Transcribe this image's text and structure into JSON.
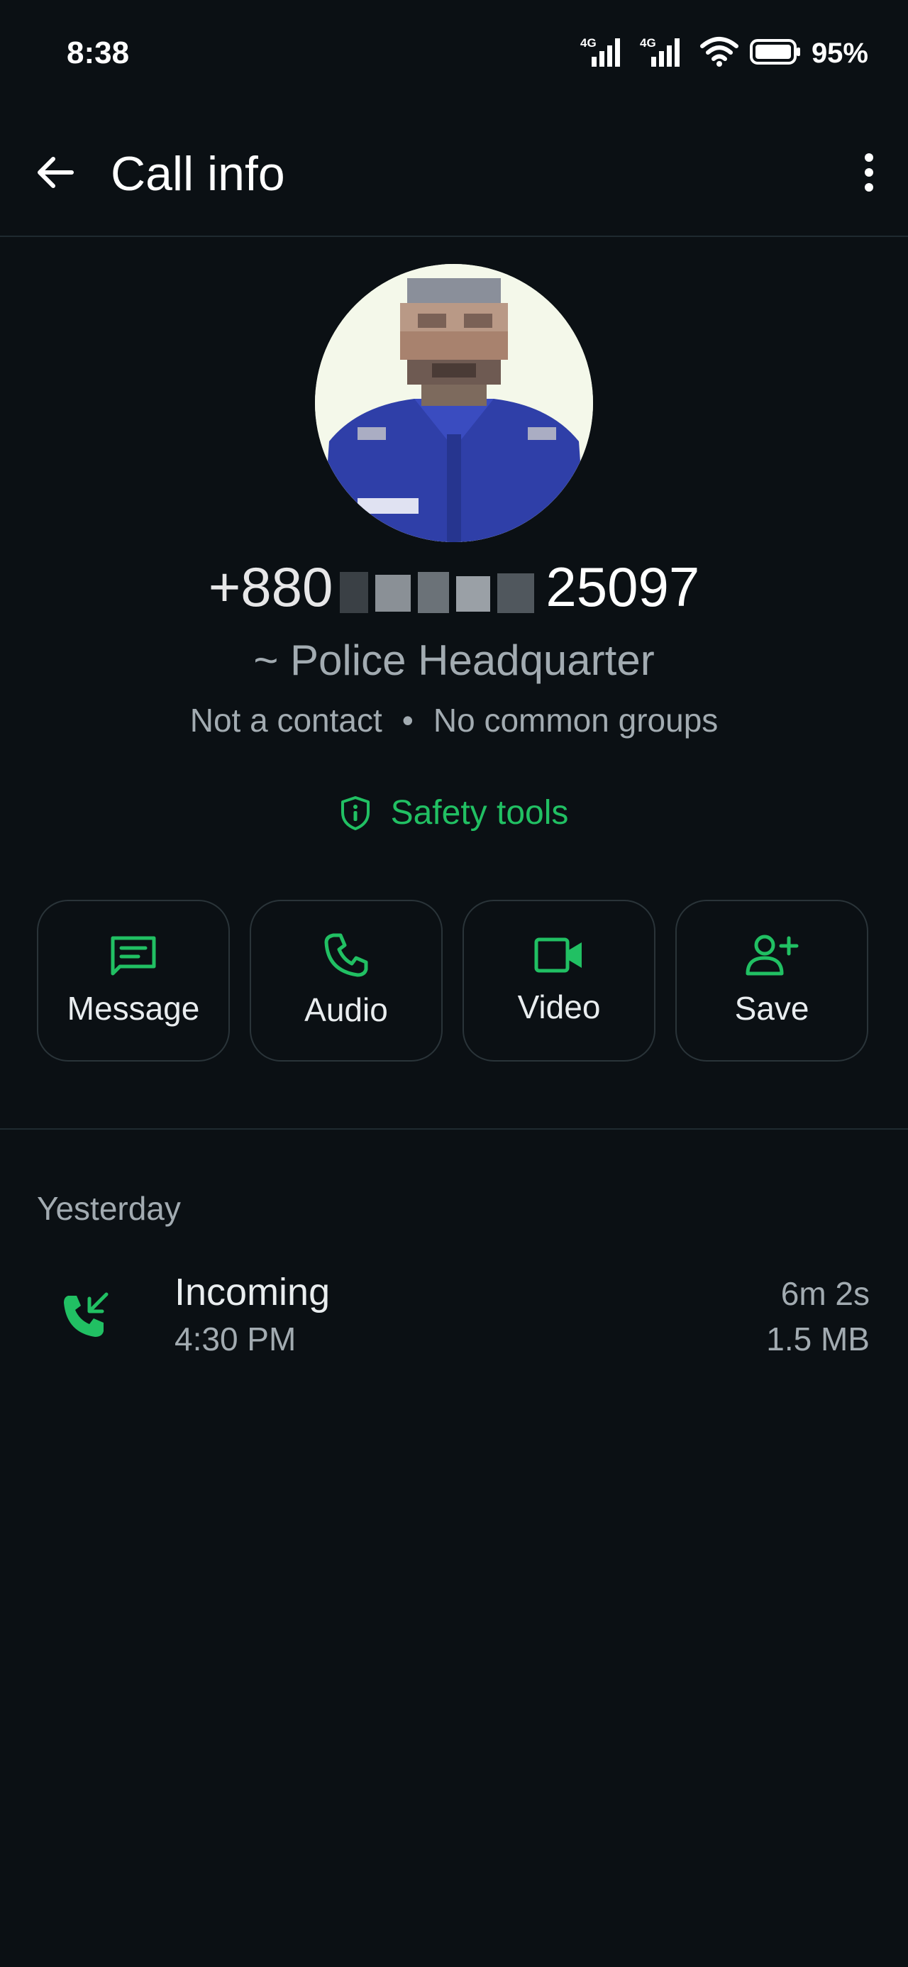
{
  "status_bar": {
    "time": "8:38",
    "network_1": "4G",
    "network_2": "4G",
    "battery_percent": "95%"
  },
  "app_bar": {
    "title": "Call info",
    "back_icon": "arrow-left-icon",
    "menu_icon": "more-vertical-icon"
  },
  "profile": {
    "phone_prefix": "+880",
    "phone_suffix": "25097",
    "push_name": "~ Police Headquarter",
    "contact_status": "Not a contact",
    "separator": "•",
    "groups_status": "No common groups"
  },
  "safety_tools": {
    "label": "Safety tools",
    "icon": "shield-info-icon"
  },
  "actions": [
    {
      "label": "Message",
      "icon": "message-icon"
    },
    {
      "label": "Audio",
      "icon": "phone-icon"
    },
    {
      "label": "Video",
      "icon": "video-icon"
    },
    {
      "label": "Save",
      "icon": "add-user-icon"
    }
  ],
  "calls": {
    "section_label": "Yesterday",
    "items": [
      {
        "type": "Incoming",
        "time": "4:30 PM",
        "duration": "6m 2s",
        "size": "1.5 MB",
        "icon": "incoming-call-icon"
      }
    ]
  },
  "colors": {
    "background": "#0b1014",
    "accent": "#21c063",
    "text_primary": "#e9edef",
    "text_secondary": "#a2abb1",
    "border": "#2a3439"
  }
}
